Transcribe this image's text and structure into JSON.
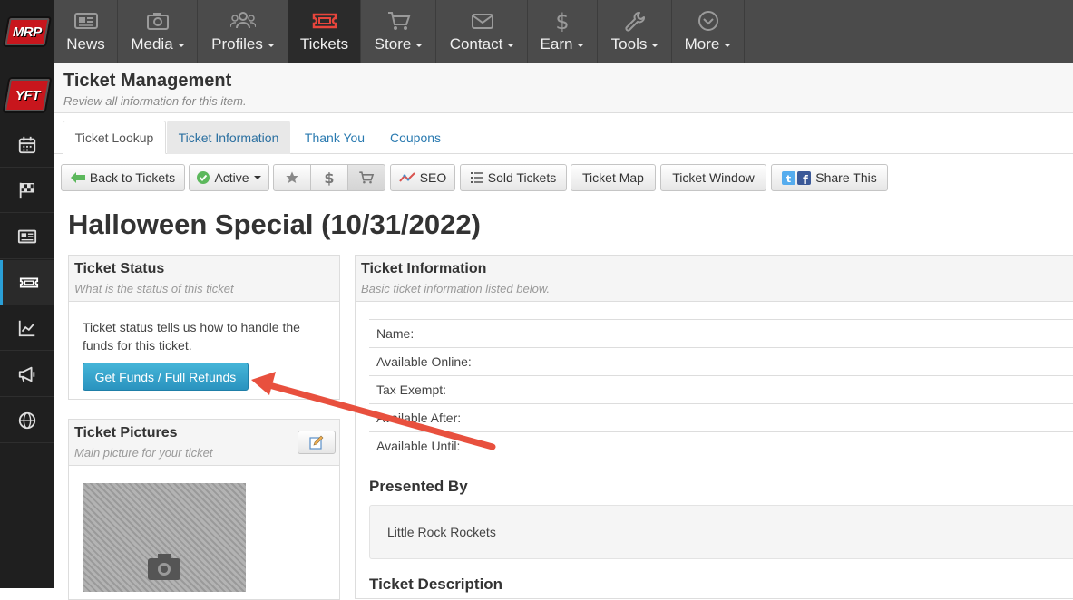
{
  "rail": {
    "logos": [
      "MRP",
      "YFT"
    ],
    "items": [
      {
        "icon": "calendar-icon"
      },
      {
        "icon": "checkered-flag-icon"
      },
      {
        "icon": "newspaper-icon"
      },
      {
        "icon": "ticket-icon",
        "active": true
      },
      {
        "icon": "trending-chart-icon"
      },
      {
        "icon": "megaphone-icon"
      },
      {
        "icon": "globe-icon"
      }
    ]
  },
  "topnav": {
    "items": [
      {
        "label": "News",
        "icon": "newspaper-icon",
        "dropdown": false
      },
      {
        "label": "Media",
        "icon": "camera-icon",
        "dropdown": true
      },
      {
        "label": "Profiles",
        "icon": "users-icon",
        "dropdown": true
      },
      {
        "label": "Tickets",
        "icon": "ticket-icon",
        "dropdown": false,
        "active": true
      },
      {
        "label": "Store",
        "icon": "cart-icon",
        "dropdown": true
      },
      {
        "label": "Contact",
        "icon": "envelope-icon",
        "dropdown": true
      },
      {
        "label": "Earn",
        "icon": "dollar-icon",
        "dropdown": true
      },
      {
        "label": "Tools",
        "icon": "wrench-icon",
        "dropdown": true
      },
      {
        "label": "More",
        "icon": "chevron-circle-icon",
        "dropdown": true
      }
    ]
  },
  "header": {
    "title": "Ticket Management",
    "subtitle": "Review all information for this item."
  },
  "tabs": [
    "Ticket Lookup",
    "Ticket Information",
    "Thank You",
    "Coupons"
  ],
  "toolbar": {
    "back": "Back to Tickets",
    "active": "Active",
    "seo": "SEO",
    "sold": "Sold Tickets",
    "map": "Ticket Map",
    "window": "Ticket Window",
    "share": "Share This"
  },
  "ticket": {
    "title": "Halloween Special (10/31/2022)"
  },
  "status_panel": {
    "title": "Ticket Status",
    "subtitle": "What is the status of this ticket",
    "text": "Ticket status tells us how to handle the funds for this ticket.",
    "button": "Get Funds / Full Refunds"
  },
  "pictures_panel": {
    "title": "Ticket Pictures",
    "subtitle": "Main picture for your ticket"
  },
  "info_panel": {
    "title": "Ticket Information",
    "subtitle": "Basic ticket information listed below.",
    "rows": [
      "Name:",
      "Available Online:",
      "Tax Exempt:",
      "Available After:",
      "Available Until:"
    ],
    "presented_label": "Presented By",
    "presented_value": "Little Rock Rockets",
    "description_label": "Ticket Description"
  },
  "colors": {
    "rail_bg": "#1f1f1f",
    "nav_bg": "#4b4b4b",
    "accent_blue": "#2a93bf",
    "arrow_red": "#e8503e"
  }
}
